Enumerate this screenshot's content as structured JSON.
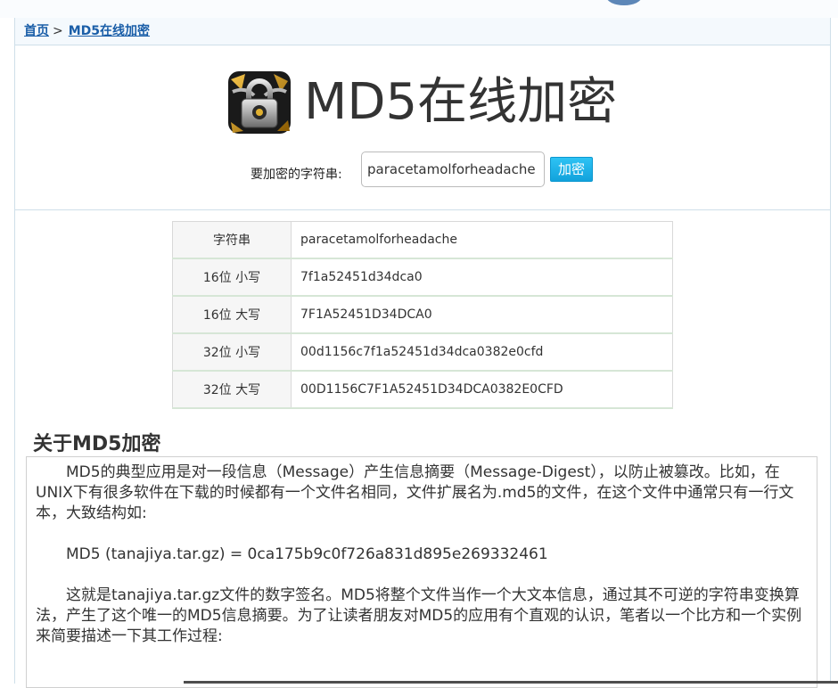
{
  "breadcrumb": {
    "home": "首页",
    "separator": ">",
    "current": "MD5在线加密"
  },
  "hero": {
    "title": "MD5在线加密",
    "logo_icon": "padlock-chain-icon",
    "input_label": "要加密的字符串:",
    "input_value": "paracetamolforheadache",
    "button_label": "加密"
  },
  "results": {
    "rows": [
      {
        "label": "字符串",
        "value": "paracetamolforheadache"
      },
      {
        "label": "16位 小写",
        "value": "7f1a52451d34dca0"
      },
      {
        "label": "16位 大写",
        "value": "7F1A52451D34DCA0"
      },
      {
        "label": "32位 小写",
        "value": "00d1156c7f1a52451d34dca0382e0cfd"
      },
      {
        "label": "32位 大写",
        "value": "00D1156C7F1A52451D34DCA0382E0CFD"
      }
    ]
  },
  "about": {
    "heading": "关于MD5加密",
    "paragraphs": [
      "MD5的典型应用是对一段信息（Message）产生信息摘要（Message-Digest），以防止被篡改。比如，在UNIX下有很多软件在下载的时候都有一个文件名相同，文件扩展名为.md5的文件，在这个文件中通常只有一行文本，大致结构如:",
      "MD5 (tanajiya.tar.gz) = 0ca175b9c0f726a831d895e269332461",
      "这就是tanajiya.tar.gz文件的数字签名。MD5将整个文件当作一个大文本信息，通过其不可逆的字符串变换算法，产生了这个唯一的MD5信息摘要。为了让读者朋友对MD5的应用有个直观的认识，笔者以一个比方和一个实例来简要描述一下其工作过程:"
    ]
  },
  "colors": {
    "link": "#1a5ea8",
    "button": "#12a2dc",
    "border": "#cfdfe9"
  }
}
